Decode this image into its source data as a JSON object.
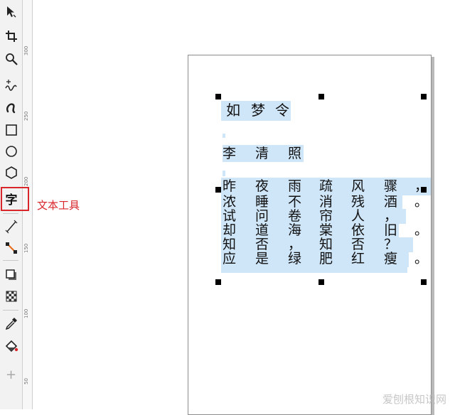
{
  "toolbox": {
    "tools": [
      "pick-tool",
      "crop-tool",
      "zoom-tool",
      "freehand-tool",
      "artistic-media-tool",
      "rectangle-tool",
      "ellipse-tool",
      "polygon-tool",
      "text-tool",
      "parallel-dimension-tool",
      "connector-tool",
      "drop-shadow-tool",
      "transparency-tool",
      "color-eyedropper-tool",
      "interactive-fill-tool",
      "add-tool"
    ],
    "text_tool_glyph": "字",
    "add_glyph": "+"
  },
  "annotation": {
    "text_tool_label": "文本工具",
    "color": "#d8262b"
  },
  "ruler": {
    "labels": [
      "300",
      "250",
      "200",
      "150",
      "100",
      "50"
    ]
  },
  "document": {
    "title": [
      "如",
      "梦",
      "令"
    ],
    "author": [
      "李",
      "清",
      "照"
    ],
    "poem_columns": [
      [
        "昨",
        "夜",
        "雨",
        "疏",
        "风",
        "骤",
        "，"
      ],
      [
        "浓",
        "睡",
        "不",
        "消",
        "残",
        "酒",
        "。"
      ],
      [
        "试",
        "问",
        "卷",
        "帘",
        "人",
        "，",
        ""
      ],
      [
        "却",
        "道",
        "海",
        "棠",
        "依",
        "旧",
        "。"
      ],
      [
        "知",
        "否",
        "，",
        "知",
        "否",
        "？",
        ""
      ],
      [
        "应",
        "是",
        "绿",
        "肥",
        "红",
        "瘦",
        "。"
      ]
    ],
    "selection_color": "#cfe5f8"
  },
  "watermark": "爱刨根知识网"
}
